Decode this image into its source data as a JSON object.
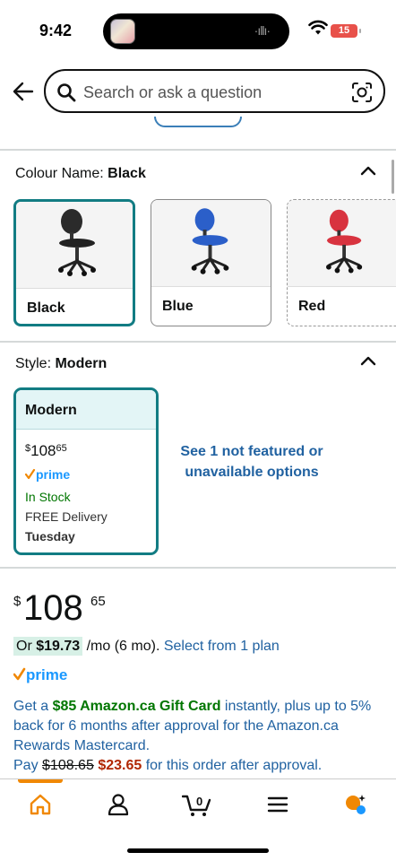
{
  "status": {
    "time": "9:42",
    "battery": "15"
  },
  "search": {
    "placeholder": "Search or ask a question"
  },
  "colour": {
    "label": "Colour Name:",
    "selected": "Black",
    "options": [
      {
        "name": "Black",
        "color": "#222222"
      },
      {
        "name": "Blue",
        "color": "#2b5fc9"
      },
      {
        "name": "Red",
        "color": "#d8333f"
      }
    ]
  },
  "style": {
    "label": "Style:",
    "selected": "Modern",
    "card": {
      "name": "Modern",
      "price_currency": "$",
      "price_whole": "108",
      "price_fraction": "65",
      "prime": "prime",
      "stock": "In Stock",
      "delivery": "FREE Delivery",
      "day": "Tuesday"
    },
    "see_more": "See 1 not featured or unavailable options"
  },
  "price": {
    "currency": "$",
    "whole": "108",
    "fraction": "65",
    "monthly_prefix": "Or ",
    "monthly_amount": "$19.73",
    "monthly_suffix": " /mo (6 mo). ",
    "monthly_link": "Select from 1 plan",
    "prime": "prime"
  },
  "promo": {
    "t1": "Get a ",
    "gift": "$85 Amazon.ca Gift Card",
    "t2": " instantly, plus up to 5% back for 6 months after approval for the Amazon.ca Rewards Mastercard.",
    "pay": "Pay ",
    "old_price": "$108.65",
    "new_price": "$23.65",
    "t3": " for this order after approval."
  },
  "nav": {
    "items": [
      "home-icon",
      "account-icon",
      "cart-icon",
      "menu-icon",
      "rufus-icon"
    ],
    "cart_count": "0",
    "accent": "#f08804"
  },
  "colors": {
    "teal": "#127c83",
    "link": "#2162a1",
    "green": "#007600",
    "red": "#b12704"
  }
}
